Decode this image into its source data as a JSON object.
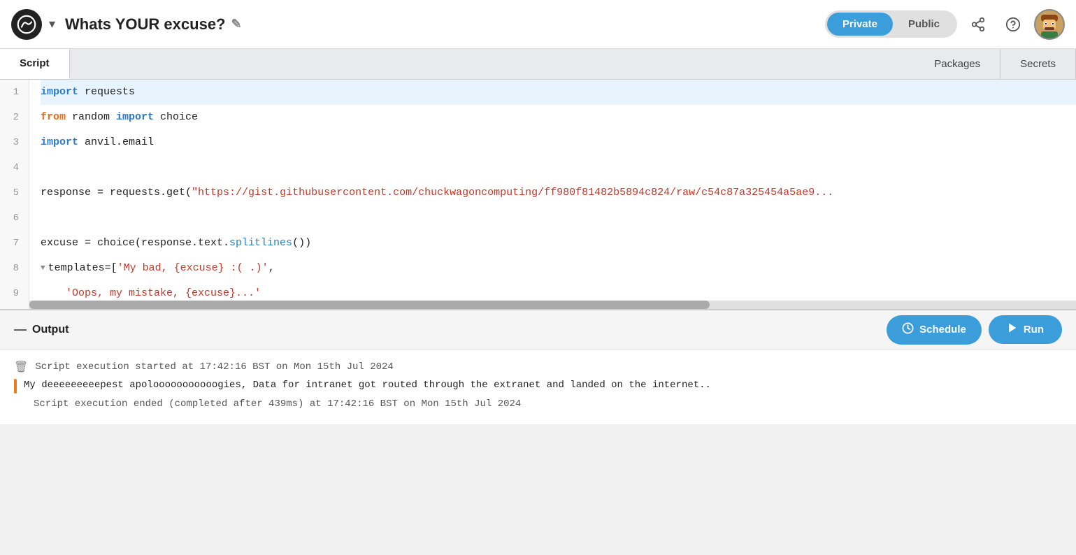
{
  "header": {
    "logo_alt": "Anvil logo",
    "chevron": "▾",
    "title": "Whats YOUR excuse?",
    "edit_icon": "✎",
    "private_label": "Private",
    "public_label": "Public",
    "share_icon": "share",
    "help_icon": "?",
    "avatar_alt": "User avatar"
  },
  "tabs": [
    {
      "id": "script",
      "label": "Script",
      "active": true
    },
    {
      "id": "packages",
      "label": "Packages",
      "active": false
    },
    {
      "id": "secrets",
      "label": "Secrets",
      "active": false
    }
  ],
  "code": {
    "lines": [
      {
        "number": 1,
        "tokens": [
          {
            "type": "kw-import",
            "text": "import"
          },
          {
            "type": "normal",
            "text": " requests"
          }
        ],
        "highlighted": true,
        "fold": false
      },
      {
        "number": 2,
        "tokens": [
          {
            "type": "kw-from",
            "text": "from"
          },
          {
            "type": "normal",
            "text": " random "
          },
          {
            "type": "kw-import",
            "text": "import"
          },
          {
            "type": "normal",
            "text": " choice"
          }
        ],
        "highlighted": false,
        "fold": false
      },
      {
        "number": 3,
        "tokens": [
          {
            "type": "kw-import",
            "text": "import"
          },
          {
            "type": "normal",
            "text": " anvil.email"
          }
        ],
        "highlighted": false,
        "fold": false
      },
      {
        "number": 4,
        "tokens": [],
        "highlighted": false,
        "fold": false
      },
      {
        "number": 5,
        "tokens": [
          {
            "type": "normal",
            "text": "    response = requests.get("
          },
          {
            "type": "string",
            "text": "\"https://gist.githubusercontent.com/chuckwagoncomputing/ff980f81482b5894c824/raw/c54c87a325454a5ae9"
          },
          {
            "type": "normal",
            "text": ""
          }
        ],
        "highlighted": false,
        "fold": false
      },
      {
        "number": 6,
        "tokens": [],
        "highlighted": false,
        "fold": false
      },
      {
        "number": 7,
        "tokens": [
          {
            "type": "normal",
            "text": "    excuse = choice(response.text."
          },
          {
            "type": "method",
            "text": "splitlines"
          },
          {
            "type": "normal",
            "text": "())"
          }
        ],
        "highlighted": false,
        "fold": false
      },
      {
        "number": 8,
        "tokens": [
          {
            "type": "normal",
            "text": "    templates=["
          },
          {
            "type": "string",
            "text": "'My bad, {excuse} :( .)'"
          },
          {
            "type": "normal",
            "text": ","
          }
        ],
        "highlighted": false,
        "fold": true
      },
      {
        "number": 9,
        "tokens": [
          {
            "type": "string",
            "text": "        'Oops, my mistake, {excuse}...'"
          }
        ],
        "highlighted": false,
        "fold": false
      }
    ]
  },
  "output": {
    "section_label": "Output",
    "schedule_label": "Schedule",
    "run_label": "Run",
    "log_lines": [
      {
        "type": "system",
        "text": "Script execution started at 17:42:16 BST on Mon 15th Jul 2024"
      },
      {
        "type": "main",
        "text": "My deeeeeeeeepest apolooooooooooogies, Data for intranet got routed through the extranet and landed on the internet.."
      },
      {
        "type": "system",
        "text": "Script execution ended (completed after 439ms) at 17:42:16 BST on Mon 15th Jul 2024"
      }
    ]
  }
}
